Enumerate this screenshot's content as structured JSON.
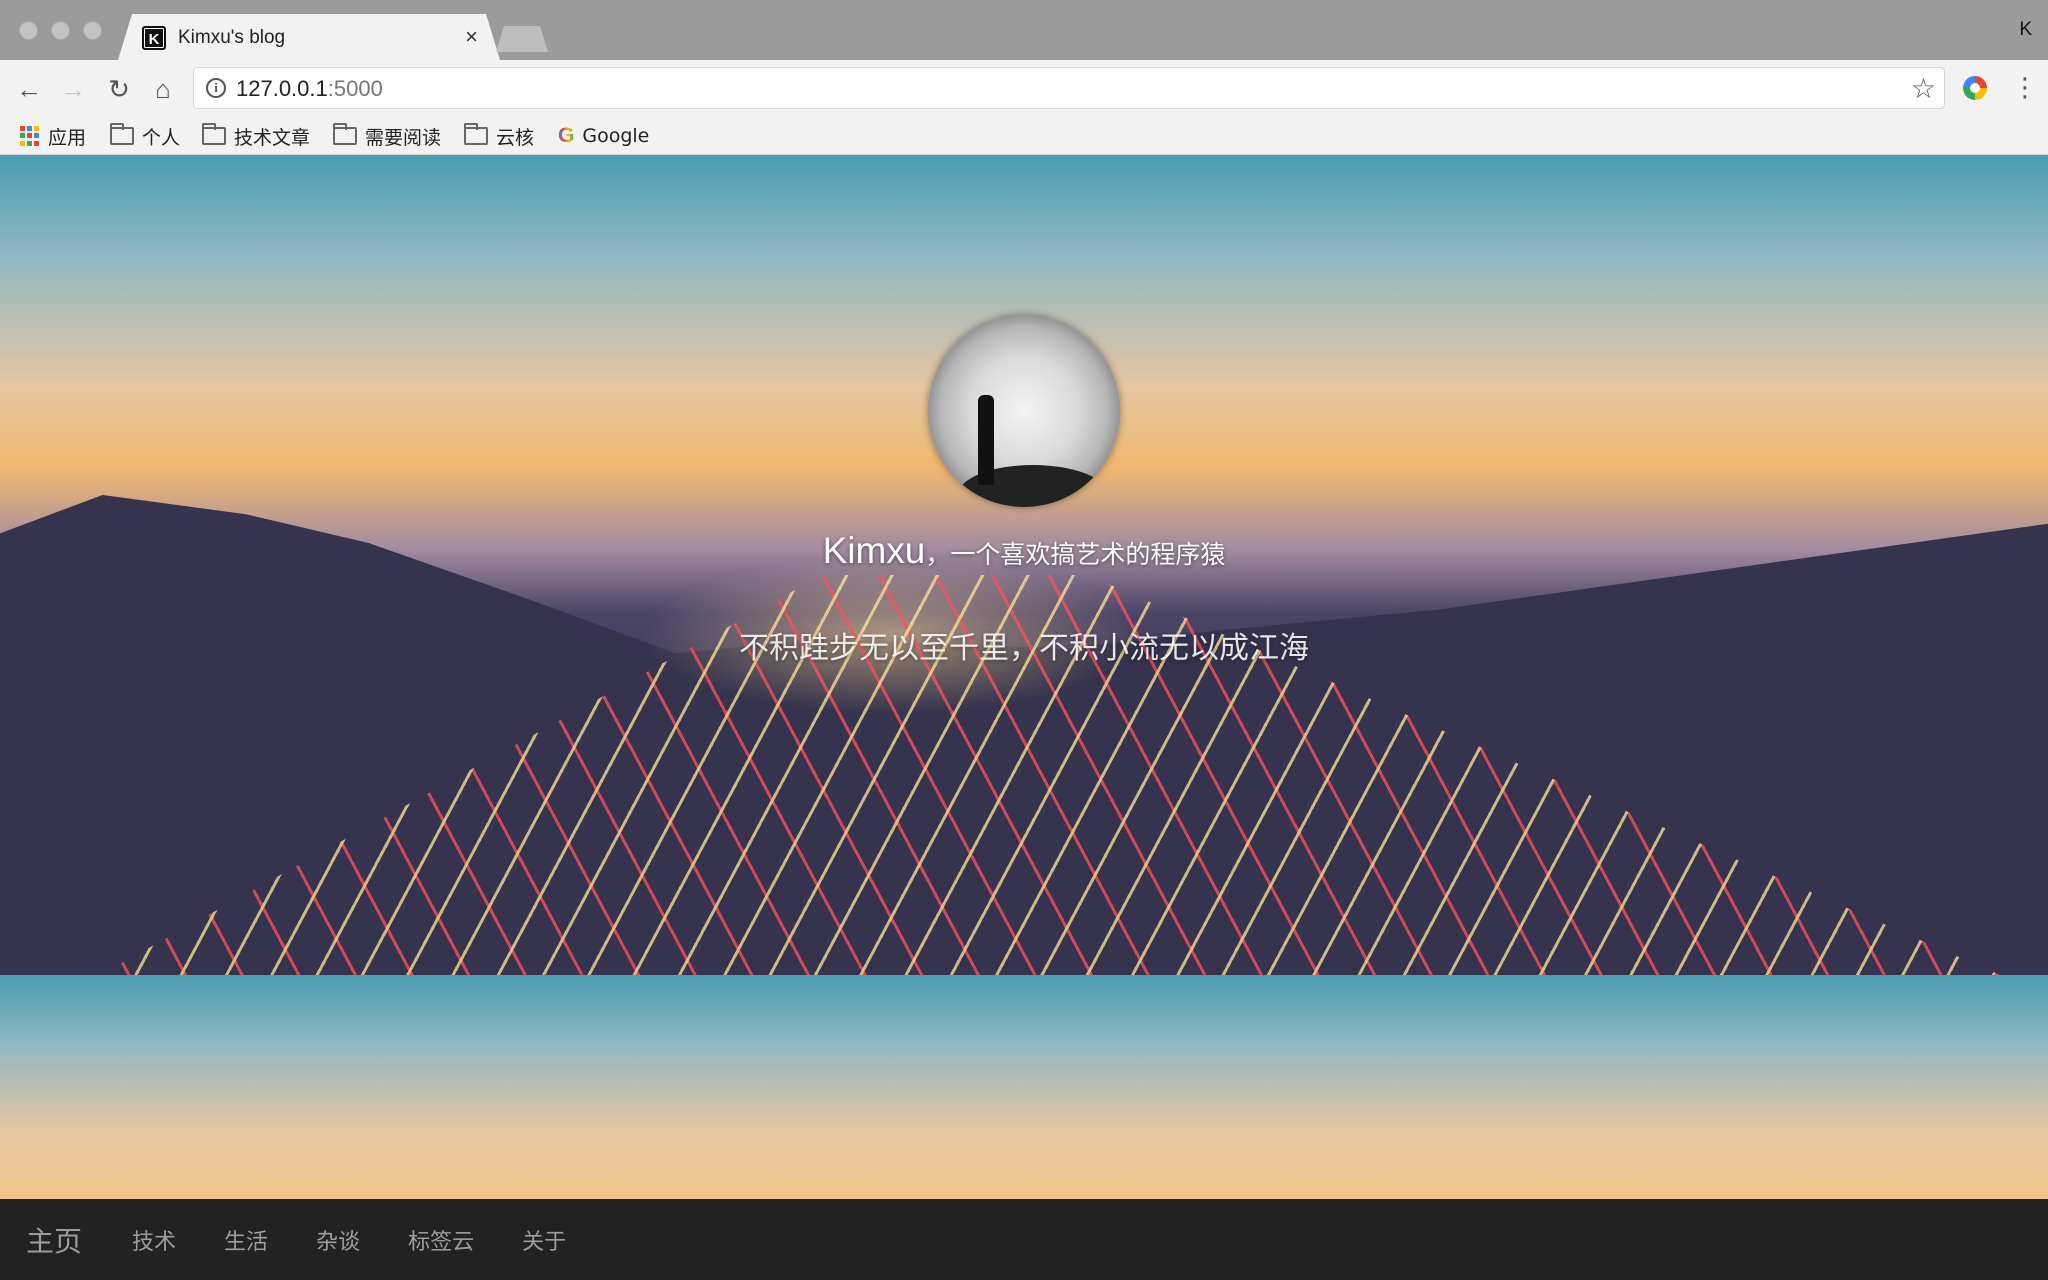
{
  "browser": {
    "tab_title": "Kimxu's blog",
    "tab_favicon_letter": "K",
    "tab_close": "×",
    "profile_initial": "K",
    "url_host": "127.0.0.1",
    "url_port": ":5000",
    "bookmarks": [
      {
        "label": "应用",
        "icon": "apps-grid-icon"
      },
      {
        "label": "个人",
        "icon": "folder-icon"
      },
      {
        "label": "技术文章",
        "icon": "folder-icon"
      },
      {
        "label": "需要阅读",
        "icon": "folder-icon"
      },
      {
        "label": "云核",
        "icon": "folder-icon"
      },
      {
        "label": "Google",
        "icon": "google-icon"
      }
    ]
  },
  "hero": {
    "name": "Kimxu",
    "separator": "，",
    "tagline": "一个喜欢搞艺术的程序猿",
    "motto": "不积跬步无以至千里，不积小流无以成江海"
  },
  "nav": {
    "brand": "主页",
    "items": [
      "技术",
      "生活",
      "杂谈",
      "标签云",
      "关于"
    ]
  },
  "colors": {
    "navbar_bg": "#222222",
    "nav_text": "#9d9d9d",
    "chrome_bg": "#f2f2f2"
  }
}
